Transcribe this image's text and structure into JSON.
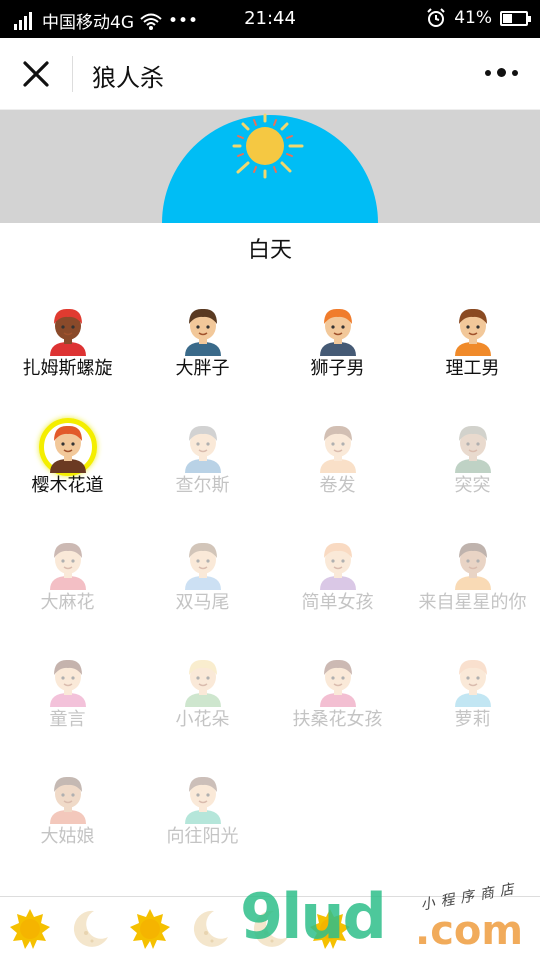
{
  "statusbar": {
    "carrier": "中国移动4G",
    "dots": "•••",
    "time": "21:44",
    "battery": "41%",
    "battery_level": 0.41
  },
  "navbar": {
    "title": "狼人杀"
  },
  "phase": {
    "label": "白天"
  },
  "colors": {
    "sky_background": "#d3d3d3",
    "sun_half_disk": "#00bdf5",
    "sun": "#f5c842",
    "highlight_ring": "#f4ee00",
    "dim_text": "#c4c4c4"
  },
  "players": [
    {
      "name": "扎姆斯螺旋",
      "avatar": "boy-red-cap-icon",
      "active": true
    },
    {
      "name": "大胖子",
      "avatar": "boy-spiky-hair-icon",
      "active": true
    },
    {
      "name": "狮子男",
      "avatar": "boy-orange-hair-icon",
      "active": true
    },
    {
      "name": "理工男",
      "avatar": "boy-glasses-icon",
      "active": true
    },
    {
      "name": "樱木花道",
      "avatar": "boy-red-hair-icon",
      "active": true,
      "selected": true
    },
    {
      "name": "查尔斯",
      "avatar": "man-grey-hair-icon",
      "active": false
    },
    {
      "name": "卷发",
      "avatar": "man-curly-hair-icon",
      "active": false
    },
    {
      "name": "突突",
      "avatar": "old-man-glasses-icon",
      "active": false
    },
    {
      "name": "大麻花",
      "avatar": "girl-pigtails-icon",
      "active": false
    },
    {
      "name": "双马尾",
      "avatar": "girl-twintails-icon",
      "active": false
    },
    {
      "name": "简单女孩",
      "avatar": "girl-long-hair-icon",
      "active": false
    },
    {
      "name": "来自星星的你",
      "avatar": "girl-curly-hair-icon",
      "active": false
    },
    {
      "name": "童言",
      "avatar": "girl-bob-hair-icon",
      "active": false
    },
    {
      "name": "小花朵",
      "avatar": "girl-blonde-icon",
      "active": false
    },
    {
      "name": "扶桑花女孩",
      "avatar": "girl-flower-icon",
      "active": false
    },
    {
      "name": "萝莉",
      "avatar": "girl-buns-icon",
      "active": false
    },
    {
      "name": "大姑娘",
      "avatar": "woman-bun-icon",
      "active": false
    },
    {
      "name": "向往阳光",
      "avatar": "woman-long-hair-icon",
      "active": false
    }
  ],
  "bottombar": {
    "tabs": [
      "sun-icon",
      "moon-icon",
      "sun-icon",
      "moon-icon",
      "moon-icon",
      "sun-icon"
    ]
  },
  "watermark": {
    "main": "9lud",
    "suffix": ".com",
    "tagline": "小程序商店"
  }
}
